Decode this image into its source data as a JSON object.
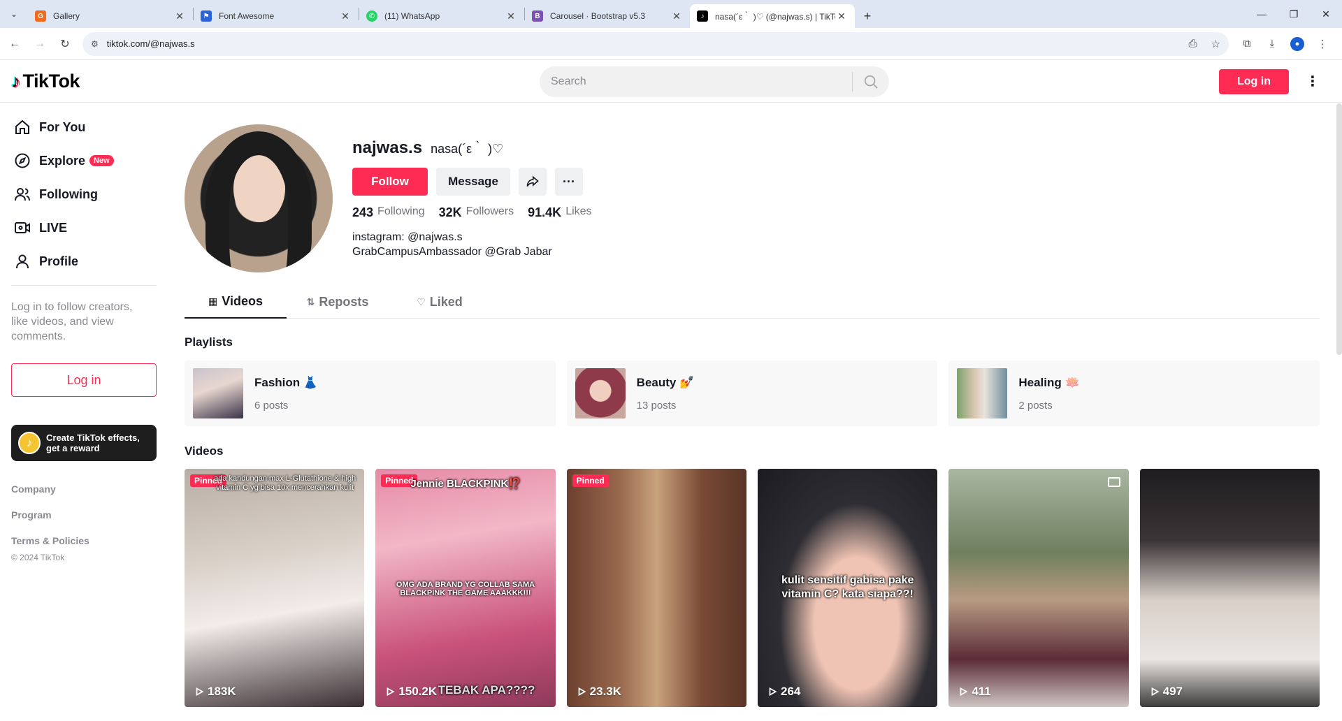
{
  "browser": {
    "tabs": [
      {
        "title": "Gallery",
        "fav_color": "#f26b1d",
        "fav_glyph": "G"
      },
      {
        "title": "Font Awesome",
        "fav_color": "#2a64d7",
        "fav_glyph": "⚑"
      },
      {
        "title": "(11) WhatsApp",
        "fav_color": "#25d366",
        "fav_glyph": "✆"
      },
      {
        "title": "Carousel · Bootstrap v5.3",
        "fav_color": "#7952b3",
        "fav_glyph": "B"
      },
      {
        "title": "nasa(´ε｀ )♡ (@najwas.s) | TikTok",
        "fav_color": "#000000",
        "fav_glyph": "♪"
      }
    ],
    "url": "tiktok.com/@najwas.s"
  },
  "header": {
    "logo": "TikTok",
    "search_placeholder": "Search",
    "login_label": "Log in"
  },
  "sidebar": {
    "nav": [
      {
        "label": "For You",
        "icon": "home-icon"
      },
      {
        "label": "Explore",
        "icon": "compass-icon",
        "badge": "New"
      },
      {
        "label": "Following",
        "icon": "users-icon"
      },
      {
        "label": "LIVE",
        "icon": "live-icon"
      },
      {
        "label": "Profile",
        "icon": "person-icon"
      }
    ],
    "login_prompt": "Log in to follow creators, like videos, and view comments.",
    "login_label": "Log in",
    "effects_line1": "Create TikTok effects,",
    "effects_line2": "get a reward",
    "links": [
      "Company",
      "Program",
      "Terms & Policies"
    ],
    "copyright": "© 2024 TikTok"
  },
  "profile": {
    "username": "najwas.s",
    "nickname": "nasa(´ε｀ )♡",
    "follow_label": "Follow",
    "message_label": "Message",
    "more_label": "···",
    "following_count": "243",
    "following_label": "Following",
    "followers_count": "32K",
    "followers_label": "Followers",
    "likes_count": "91.4K",
    "likes_label": "Likes",
    "bio_line1": "instagram: @najwas.s",
    "bio_line2": "GrabCampusAmbassador @Grab Jabar"
  },
  "tabs": [
    {
      "label": "Videos",
      "icon": "▦"
    },
    {
      "label": "Reposts",
      "icon": "⇅"
    },
    {
      "label": "Liked",
      "icon": "♡"
    }
  ],
  "playlists_title": "Playlists",
  "playlists": [
    {
      "name": "Fashion 👗",
      "posts": "6 posts"
    },
    {
      "name": "Beauty 💅",
      "posts": "13 posts"
    },
    {
      "name": "Healing 🪷",
      "posts": "2 posts"
    }
  ],
  "videos_title": "Videos",
  "videos": [
    {
      "pinned": "Pinned",
      "views": "183K",
      "caption": "ada kandungan max L-Glutathione & high vitamin C yg bisa 10x mencerahkan kulit"
    },
    {
      "pinned": "Pinned",
      "views": "150.2K",
      "caption": "Jennie BLACKPINK⁉️",
      "caption2": "OMG ADA BRAND YG COLLAB SAMA BLACKPINK THE GAME AAAKKK!!!",
      "caption3": "TEBAK APA????"
    },
    {
      "pinned": "Pinned",
      "views": "23.3K"
    },
    {
      "views": "264",
      "caption": "kulit sensitif gabisa pake vitamin C? kata siapa??!"
    },
    {
      "views": "411"
    },
    {
      "views": "497"
    }
  ]
}
